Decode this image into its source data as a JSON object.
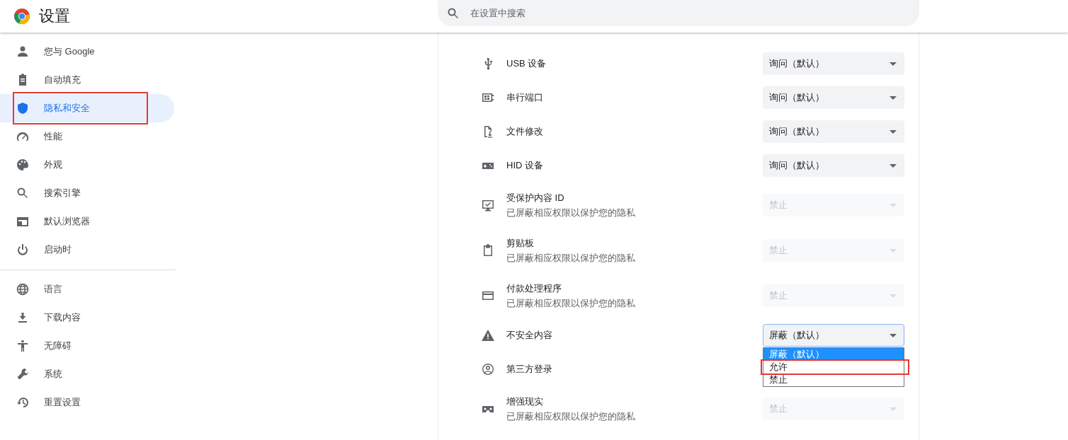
{
  "header": {
    "title": "设置",
    "search": {
      "placeholder": "在设置中搜索"
    }
  },
  "sidebar": {
    "groups": [
      {
        "items": [
          {
            "label": "您与 Google",
            "selected": false,
            "highlighted": false
          },
          {
            "label": "自动填充",
            "selected": false,
            "highlighted": false
          },
          {
            "label": "隐私和安全",
            "selected": true,
            "highlighted": true
          },
          {
            "label": "性能",
            "selected": false,
            "highlighted": false
          },
          {
            "label": "外观",
            "selected": false,
            "highlighted": false
          },
          {
            "label": "搜索引擎",
            "selected": false,
            "highlighted": false
          },
          {
            "label": "默认浏览器",
            "selected": false,
            "highlighted": false
          },
          {
            "label": "启动时",
            "selected": false,
            "highlighted": false
          }
        ]
      },
      {
        "items": [
          {
            "label": "语言",
            "selected": false,
            "highlighted": false
          },
          {
            "label": "下载内容",
            "selected": false,
            "highlighted": false
          },
          {
            "label": "无障碍",
            "selected": false,
            "highlighted": false
          },
          {
            "label": "系统",
            "selected": false,
            "highlighted": false
          },
          {
            "label": "重置设置",
            "selected": false,
            "highlighted": false
          }
        ]
      }
    ]
  },
  "rows": [
    {
      "label": "USB 设备",
      "value": "询问（默认）",
      "disabled": false
    },
    {
      "label": "串行端口",
      "value": "询问（默认）",
      "disabled": false
    },
    {
      "label": "文件修改",
      "value": "询问（默认）",
      "disabled": false
    },
    {
      "label": "HID 设备",
      "value": "询问（默认）",
      "disabled": false
    },
    {
      "label": "受保护内容 ID",
      "sublabel": "已屏蔽相应权限以保护您的隐私",
      "value": "禁止",
      "disabled": true
    },
    {
      "label": "剪贴板",
      "sublabel": "已屏蔽相应权限以保护您的隐私",
      "value": "禁止",
      "disabled": true
    },
    {
      "label": "付款处理程序",
      "sublabel": "已屏蔽相应权限以保护您的隐私",
      "value": "禁止",
      "disabled": true
    },
    {
      "label": "不安全内容",
      "value": "屏蔽（默认）",
      "disabled": false,
      "options": [
        {
          "label": "屏蔽（默认）",
          "selected": true,
          "highlighted": false
        },
        {
          "label": "允许",
          "selected": false,
          "highlighted": true
        },
        {
          "label": "禁止",
          "selected": false,
          "highlighted": false
        }
      ]
    },
    {
      "label": "第三方登录"
    },
    {
      "label": "增强现实",
      "sublabel": "已屏蔽相应权限以保护您的隐私",
      "value": "禁止",
      "disabled": true
    }
  ]
}
